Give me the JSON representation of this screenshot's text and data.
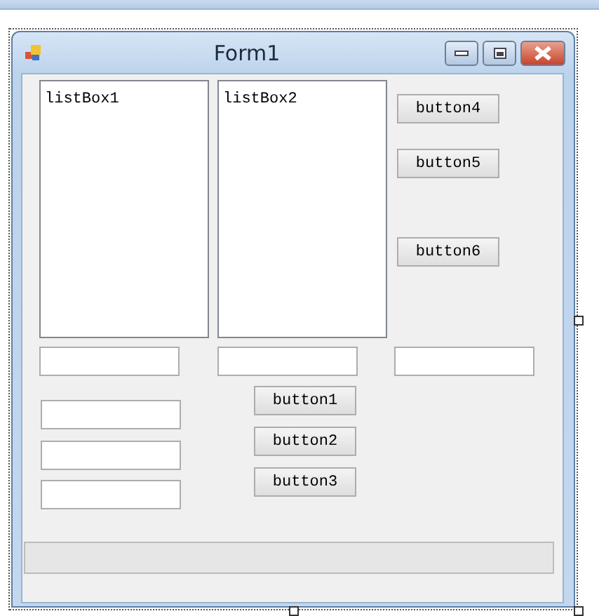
{
  "window": {
    "title": "Form1"
  },
  "list_boxes": [
    {
      "label": "listBox1"
    },
    {
      "label": "listBox2"
    }
  ],
  "buttons": [
    {
      "label": "button4"
    },
    {
      "label": "button5"
    },
    {
      "label": "button6"
    },
    {
      "label": "button1"
    },
    {
      "label": "button2"
    },
    {
      "label": "button3"
    }
  ],
  "progress_bar": {
    "level": 0
  }
}
